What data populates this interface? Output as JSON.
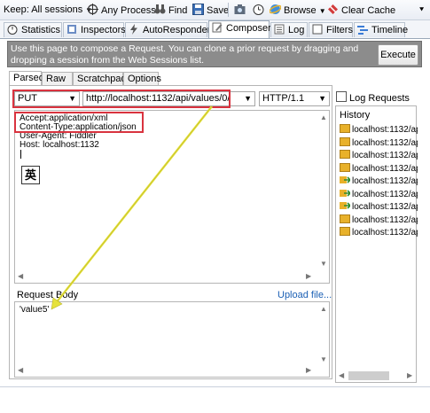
{
  "toolbar": {
    "keep": "Keep: All sessions",
    "any_process": "Any Process",
    "find": "Find",
    "save": "Save",
    "browse": "Browse",
    "clear_cache": "Clear Cache"
  },
  "tabs": {
    "statistics": "Statistics",
    "inspectors": "Inspectors",
    "autoresponder": "AutoResponder",
    "composer": "Composer",
    "log": "Log",
    "filters": "Filters",
    "timeline": "Timeline"
  },
  "info": {
    "text": "Use this page to compose a Request. You can clone a prior request by dragging and dropping a session from the Web Sessions list.",
    "execute": "Execute"
  },
  "subtabs": {
    "parsed": "Parsed",
    "raw": "Raw",
    "scratchpad": "Scratchpad",
    "options": "Options"
  },
  "request": {
    "method": "PUT",
    "url": "http://localhost:1132/api/values/0/",
    "version": "HTTP/1.1",
    "headers": [
      "Accept:application/xml",
      "Content-Type:application/json",
      "User-Agent: Fiddler",
      "Host: localhost:1132"
    ],
    "ime": "英",
    "body_label": "Request Body",
    "upload": "Upload file...",
    "body": "'value5'"
  },
  "side": {
    "log_requests": "Log Requests",
    "history_title": "History",
    "history": [
      {
        "kind": "get",
        "text": "localhost:1132/ap"
      },
      {
        "kind": "get",
        "text": "localhost:1132/ap"
      },
      {
        "kind": "get",
        "text": "localhost:1132/ap"
      },
      {
        "kind": "get",
        "text": "localhost:1132/ap"
      },
      {
        "kind": "arrow",
        "text": "localhost:1132/ap"
      },
      {
        "kind": "arrow",
        "text": "localhost:1132/ap"
      },
      {
        "kind": "arrow",
        "text": "localhost:1132/ap"
      },
      {
        "kind": "get",
        "text": "localhost:1132/ap"
      },
      {
        "kind": "get",
        "text": "localhost:1132/ap"
      }
    ]
  },
  "colors": {
    "highlight": "#d9333f",
    "drag_arrow": "#e6e23c",
    "info_bg": "#8c8c8c"
  }
}
